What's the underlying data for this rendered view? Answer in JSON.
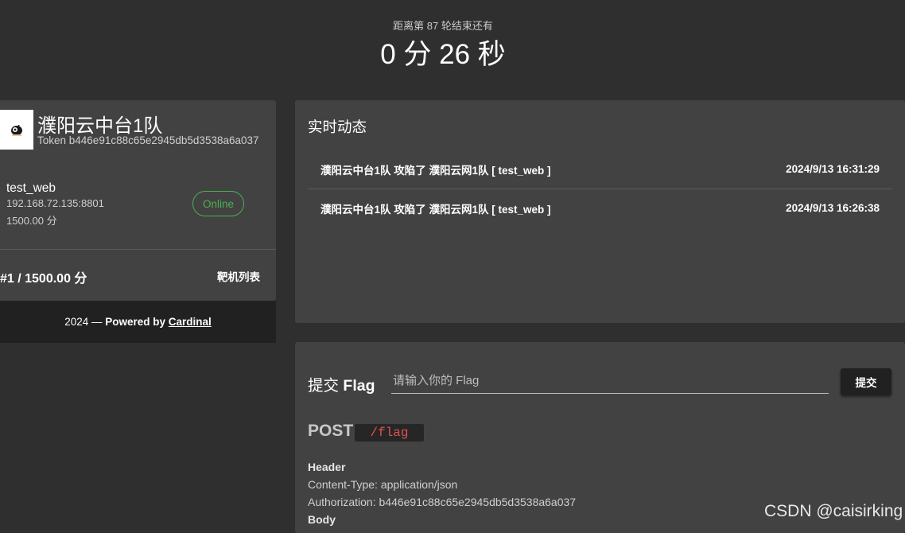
{
  "countdown": {
    "caption": "距离第 87 轮结束还有",
    "value": "0 分 26 秒"
  },
  "team": {
    "name": "濮阳云中台1队",
    "token": "Token b446e91c88c65e2945db5d3538a6a037",
    "service": {
      "name": "test_web",
      "address": "192.168.72.135:8801",
      "score": "1500.00 分",
      "status": "Online"
    },
    "rank_score": "#1 / 1500.00 分",
    "target_list_label": "靶机列表"
  },
  "footer": {
    "prefix": "2024 — ",
    "powered": "Powered by ",
    "link": "Cardinal"
  },
  "feed": {
    "title": "实时动态",
    "events": [
      {
        "text": "濮阳云中台1队 攻陷了 濮阳云网1队 [ test_web ]",
        "time": "2024/9/13 16:31:29"
      },
      {
        "text": "濮阳云中台1队 攻陷了 濮阳云网1队 [ test_web ]",
        "time": "2024/9/13 16:26:38"
      }
    ]
  },
  "submit": {
    "label_prefix": "提交 ",
    "label_bold": "Flag",
    "placeholder": "请输入你的 Flag",
    "button": "提交"
  },
  "api_doc": {
    "method": "POST",
    "path": "/flag",
    "header_title": "Header",
    "content_type": "Content-Type: application/json",
    "authorization": "Authorization: b446e91c88c65e2945db5d3538a6a037",
    "body_title": "Body"
  },
  "watermark": "CSDN @caisirking",
  "colors": {
    "background": "#2f2f2f",
    "card": "#424242",
    "footer": "#212121",
    "online": "#4caf50",
    "path_text": "#e05252"
  }
}
